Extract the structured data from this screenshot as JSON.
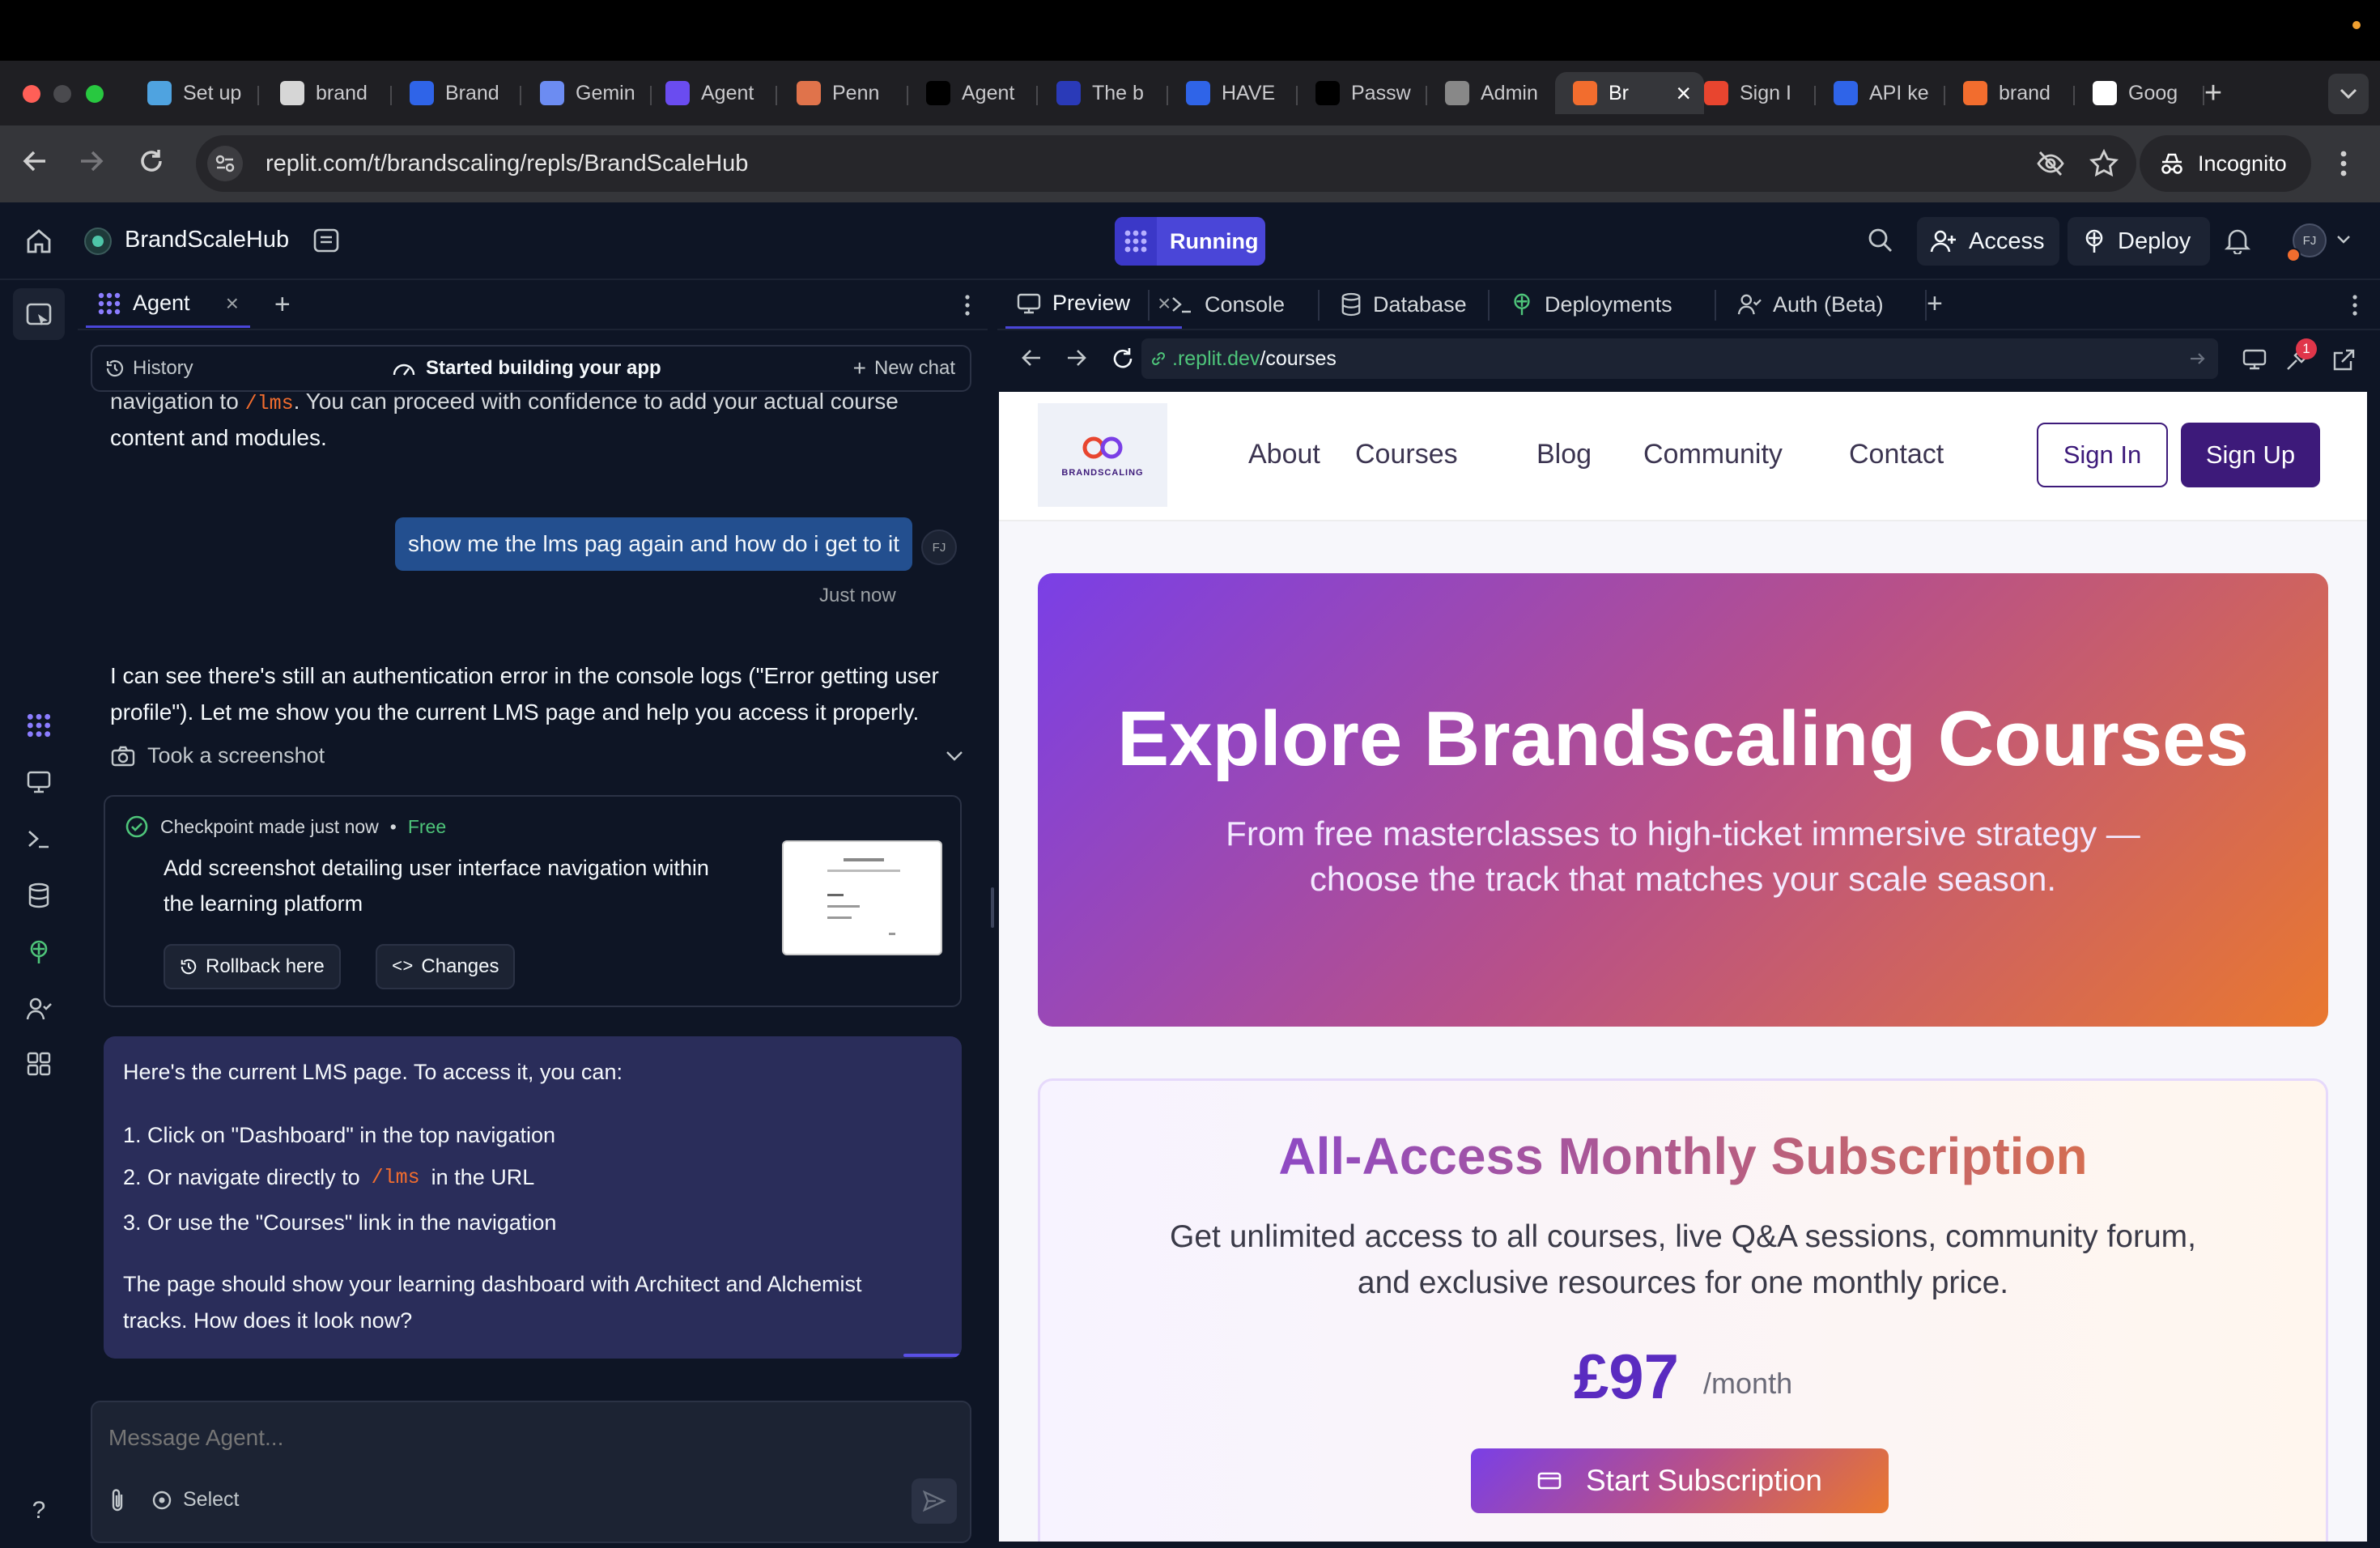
{
  "browser": {
    "tabs": [
      {
        "label": "Set up",
        "icon": "setup-icon",
        "color": "#4fa3e0"
      },
      {
        "label": "brand",
        "icon": "brand-icon",
        "color": "#d6d6d6"
      },
      {
        "label": "Brand",
        "icon": "dropbox-icon",
        "color": "#2f64e8"
      },
      {
        "label": "Gemin",
        "icon": "gemini-icon",
        "color": "#6c8cf2"
      },
      {
        "label": "Agent",
        "icon": "agent-icon",
        "color": "#6a4cf0"
      },
      {
        "label": "Penn",
        "icon": "penn-icon",
        "color": "#e0734b"
      },
      {
        "label": "Agent",
        "icon": "triangle-icon",
        "color": "#000000"
      },
      {
        "label": "The b",
        "icon": "bars-icon",
        "color": "#2a3ab8"
      },
      {
        "label": "HAVE",
        "icon": "dropbox-icon",
        "color": "#2f64e8"
      },
      {
        "label": "Passw",
        "icon": "up-icon",
        "color": "#000000"
      },
      {
        "label": "Admin",
        "icon": "globe-icon",
        "color": "#888888"
      },
      {
        "label": "Br",
        "icon": "replit-icon",
        "color": "#f26d2e"
      },
      {
        "label": "Sign I",
        "icon": "sign-icon",
        "color": "#e8452f"
      },
      {
        "label": "API ke",
        "icon": "api-icon",
        "color": "#2f64e8"
      },
      {
        "label": "brand",
        "icon": "fire-icon",
        "color": "#f26d2e"
      },
      {
        "label": "Goog",
        "icon": "google-icon",
        "color": "#ffffff"
      }
    ],
    "url": "replit.com/t/brandscaling/repls/BrandScaleHub",
    "incognito_label": "Incognito"
  },
  "replit": {
    "project_name": "BrandScaleHub",
    "status": "Running",
    "status_color": "#4a46d8",
    "access_label": "Access",
    "deploy_label": "Deploy",
    "avatar_initials": "FJ"
  },
  "agent": {
    "tab_label": "Agent",
    "history_label": "History",
    "started_label": "Started building your app",
    "new_chat_label": "New chat",
    "prev_text_a": "navigation to",
    "prev_code": "/lms",
    "prev_text_b": ". You can proceed with confidence to add your actual course",
    "prev_text_c": "content and modules.",
    "user_message": "show me the lms pag again and how do i get to it",
    "user_time": "Just now",
    "reply_1": "I can see there's still an authentication error in the console logs (\"Error getting user",
    "reply_2": "profile\"). Let me show you the current LMS page and help you access it properly.",
    "screenshot_label": "Took a screenshot",
    "checkpoint": {
      "title": "Checkpoint made just now",
      "badge": "Free",
      "desc_1": "Add screenshot detailing user interface navigation within",
      "desc_2": "the learning platform",
      "rollback_label": "Rollback here",
      "changes_label": "Changes"
    },
    "answer": {
      "intro": "Here's the current LMS page. To access it, you can:",
      "step1": "1. Click on \"Dashboard\" in the top navigation",
      "step2_a": "2. Or navigate directly to",
      "step2_code": "/lms",
      "step2_b": "in the URL",
      "step3": "3. Or use the \"Courses\" link in the navigation",
      "outro_1": "The page should show your learning dashboard with Architect and Alchemist",
      "outro_2": "tracks. How does it look now?"
    },
    "input_placeholder": "Message Agent...",
    "select_label": "Select"
  },
  "panes": {
    "tabs": [
      {
        "label": "Preview",
        "icon": "preview-icon"
      },
      {
        "label": "Console",
        "icon": "console-icon"
      },
      {
        "label": "Database",
        "icon": "database-icon"
      },
      {
        "label": "Deployments",
        "icon": "deployments-icon"
      },
      {
        "label": "Auth (Beta)",
        "icon": "auth-icon"
      }
    ],
    "preview_url_host": ".replit.dev",
    "preview_url_path": "/courses",
    "devtools_badge": "1"
  },
  "site": {
    "logo_text": "BRANDSCALING",
    "nav": [
      "About",
      "Courses",
      "Blog",
      "Community",
      "Contact"
    ],
    "sign_in": "Sign In",
    "sign_up": "Sign Up",
    "hero_title": "Explore Brandscaling Courses",
    "hero_sub_1": "From free masterclasses to high-ticket immersive strategy —",
    "hero_sub_2": "choose the track that matches your scale season.",
    "sub_title": "All-Access Monthly Subscription",
    "sub_desc_1": "Get unlimited access to all courses, live Q&A sessions, community forum,",
    "sub_desc_2": "and exclusive resources for one monthly price.",
    "price": "£97",
    "price_period": "/month",
    "cta": "Start Subscription",
    "brand_purple": "#3d1a7a",
    "accent_orange": "#e9782f"
  }
}
